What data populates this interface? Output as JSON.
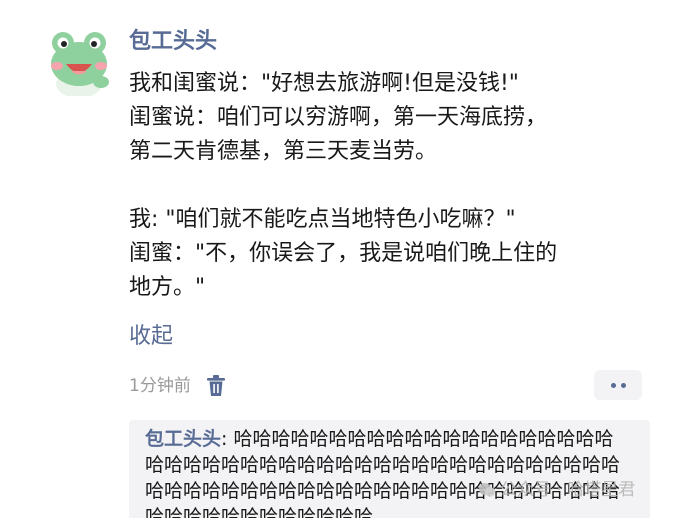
{
  "comment": {
    "username": "包工头头",
    "lines": [
      "我和闺蜜说：\"好想去旅游啊!但是没钱!\"",
      "闺蜜说：咱们可以穷游啊，第一天海底捞，",
      "第二天肯德基，第三天麦当劳。",
      "",
      "我: \"咱们就不能吃点当地特色小吃嘛？\"",
      "闺蜜：\"不，你误会了，我是说咱们晚上住的",
      "地方。\""
    ],
    "collapse_label": "收起",
    "time": "1分钟前"
  },
  "reply": {
    "author": "包工头头",
    "separator": ": ",
    "text": "哈哈哈哈哈哈哈哈哈哈哈哈哈哈哈哈哈哈哈哈哈哈哈哈哈哈哈哈哈哈哈哈哈哈哈哈哈哈哈哈哈哈哈哈哈哈哈哈哈哈哈哈哈哈哈哈哈哈哈哈哈哈哈哈哈哈哈哈哈哈哈哈哈哈哈哈哈哈哈哈哈哈"
  },
  "watermark": {
    "text": "公众号 · 哈塔星君"
  },
  "icons": {
    "avatar": "frog-avatar",
    "delete": "trash-icon",
    "more": "more-dots-icon"
  },
  "colors": {
    "link": "#576b95",
    "text": "#191919",
    "muted": "#9a9a9a",
    "reply_bg": "#f3f3f5"
  }
}
